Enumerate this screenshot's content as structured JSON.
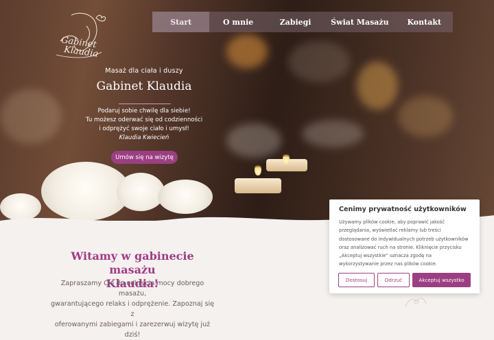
{
  "logo": {
    "text_line1": "Gabinet",
    "text_line2": "Klaudia"
  },
  "nav": {
    "items": [
      {
        "label": "Start"
      },
      {
        "label": "O mnie"
      },
      {
        "label": "Zabiegi"
      },
      {
        "label": "Świat Masażu"
      },
      {
        "label": "Kontakt"
      }
    ]
  },
  "hero": {
    "tagline": "Masaż dla ciała i duszy",
    "title": "Gabinet Klaudia",
    "desc_lines": [
      "Podaruj sobie chwilę dla siebie!",
      "Tu możesz oderwać się od codzienności",
      "i odprężyć swoje ciało i umysł!"
    ],
    "author": "Klaudia Kwiecień",
    "cta": "Umów się na wizytę"
  },
  "welcome": {
    "title_line1": "Witamy w gabinecie masażu",
    "title_line2": "Klaudia!",
    "text_lines": [
      "Zapraszamy Cię do odkrycia mocy dobrego masażu,",
      "gwarantującego relaks i odprężenie. Zapoznaj się z",
      "oferowanymi zabiegami i zarezerwuj wizytę już dziś!"
    ]
  },
  "cookie": {
    "title": "Cenimy prywatność użytkowników",
    "text_lines": [
      "Używamy plików cookie, aby poprawić jakość",
      "przeglądania, wyświetlać reklamy lub treści",
      "dostosowane do indywidualnych potrzeb użytkowników",
      "oraz analizować ruch na stronie. Kliknięcie przycisku",
      "„Akceptuj wszystkie” oznacza zgodę na",
      "wykorzystywanie przez nas plików cookie."
    ],
    "buttons": {
      "customize": "Dostosuj",
      "reject": "Odrzuć",
      "accept": "Akceptuj wszystko"
    }
  },
  "colors": {
    "accent": "#9b3f82",
    "heading": "#a03b86",
    "background": "#f4f1ef"
  }
}
